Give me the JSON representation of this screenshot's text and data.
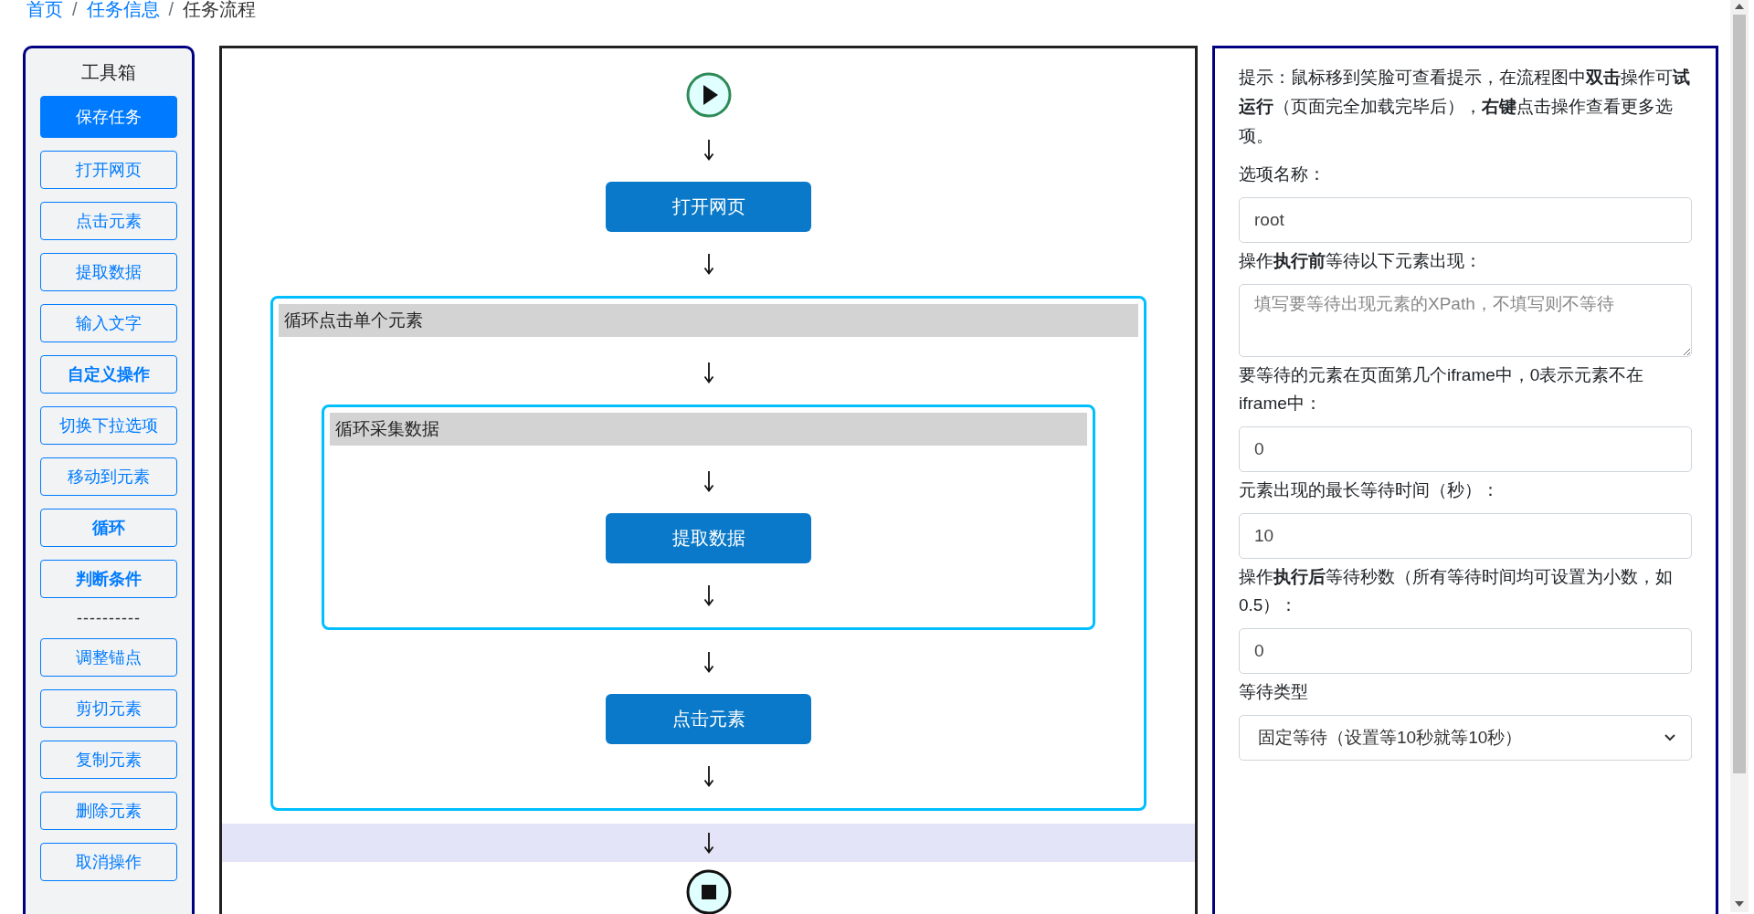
{
  "breadcrumb": [
    {
      "label": "首页",
      "kind": "link"
    },
    {
      "label": "/",
      "kind": "separator"
    },
    {
      "label": "任务信息",
      "kind": "link"
    },
    {
      "label": "/",
      "kind": "separator"
    },
    {
      "label": "任务流程",
      "kind": "current"
    }
  ],
  "toolbox": {
    "title": "工具箱",
    "buttons": [
      {
        "label": "保存任务",
        "kind": "primary"
      },
      {
        "label": "打开网页",
        "kind": "outline"
      },
      {
        "label": "点击元素",
        "kind": "outline"
      },
      {
        "label": "提取数据",
        "kind": "outline"
      },
      {
        "label": "输入文字",
        "kind": "outline"
      },
      {
        "label": "自定义操作",
        "kind": "bold"
      },
      {
        "label": "切换下拉选项",
        "kind": "outline"
      },
      {
        "label": "移动到元素",
        "kind": "outline"
      },
      {
        "label": "循环",
        "kind": "bold"
      },
      {
        "label": "判断条件",
        "kind": "bold"
      },
      {
        "label": "----------",
        "kind": "separator"
      },
      {
        "label": "调整锚点",
        "kind": "outline"
      },
      {
        "label": "剪切元素",
        "kind": "outline"
      },
      {
        "label": "复制元素",
        "kind": "outline"
      },
      {
        "label": "删除元素",
        "kind": "outline"
      },
      {
        "label": "取消操作",
        "kind": "outline"
      }
    ]
  },
  "flow": {
    "items": [
      {
        "kind": "action",
        "label": "打开网页"
      },
      {
        "kind": "loop",
        "label": "循环点击单个元素",
        "children": [
          {
            "kind": "loop",
            "label": "循环采集数据",
            "children": [
              {
                "kind": "action",
                "label": "提取数据"
              }
            ]
          },
          {
            "kind": "action",
            "label": "点击元素"
          }
        ]
      }
    ],
    "final_arrow": {
      "selected": true
    }
  },
  "options": {
    "hint": "提示：鼠标移到笑脸可查看提示，在流程图中**双击**操作可**试运行**（页面完全加载完毕后），**右键**点击操作查看更多选项。",
    "fields": [
      {
        "label": "选项名称：",
        "kind": "input",
        "value": "root"
      },
      {
        "label": "操作**执行前**等待以下元素出现：",
        "kind": "textarea",
        "placeholder": "填写要等待出现元素的XPath，不填写则不等待"
      },
      {
        "label": "要等待的元素在页面第几个iframe中，0表示元素不在iframe中：",
        "kind": "input",
        "value": "0"
      },
      {
        "label": "元素出现的最长等待时间（秒）：",
        "kind": "input",
        "value": "10"
      },
      {
        "label": "操作**执行后**等待秒数（所有等待时间均可设置为小数，如0.5）：",
        "kind": "input",
        "value": "0"
      },
      {
        "label": "等待类型",
        "kind": "select",
        "value": "固定等待（设置等10秒就等10秒）"
      }
    ]
  }
}
